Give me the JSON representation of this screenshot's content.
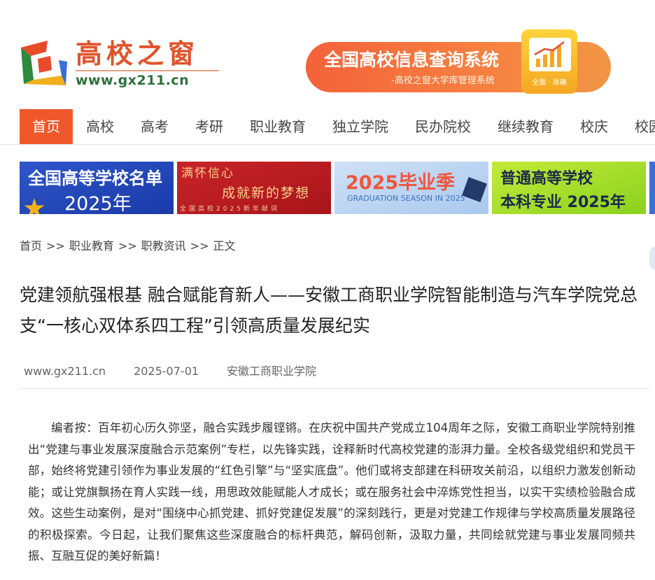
{
  "site": {
    "logo_title": "高校之窗",
    "logo_url": "www.gx211.cn"
  },
  "banner": {
    "title": "全国高校信息查询系统",
    "subtitle": "-高校之窗大学库管理系统",
    "badge_text": "全面 · 准确"
  },
  "nav": {
    "items": [
      "首页",
      "高校",
      "高考",
      "考研",
      "职业教育",
      "独立学院",
      "民办院校",
      "继续教育",
      "校庆",
      "校园"
    ],
    "active_index": 0
  },
  "tiles": [
    {
      "line1": "全国高等学校名单",
      "line2": "2025年"
    },
    {
      "line1": "满怀信心",
      "line2": "成就新的梦想",
      "line3": "全国高校2025新年献词"
    },
    {
      "line1": "2025毕业季",
      "line2": "GRADUATION SEASON IN 2025"
    },
    {
      "line1": "普通高等学校",
      "line2": "本科专业 2025年"
    }
  ],
  "breadcrumb": {
    "items": [
      "首页",
      "职业教育",
      "职教资讯",
      "正文"
    ],
    "separator": ">>"
  },
  "article": {
    "title": "党建领航强根基 融合赋能育新人——安徽工商职业学院智能制造与汽车学院党总支“一核心双体系四工程”引领高质量发展纪实",
    "source_site": "www.gx211.cn",
    "date": "2025-07-01",
    "source": "安徽工商职业学院",
    "body": "编者按：百年初心历久弥坚，融合实践步履铿锵。在庆祝中国共产党成立104周年之际，安徽工商职业学院特别推出“党建与事业发展深度融合示范案例”专栏，以先锋实践，诠释新时代高校党建的澎湃力量。全校各级党组织和党员干部，始终将党建引领作为事业发展的“红色引擎”与“坚实底盘”。他们或将支部建在科研攻关前沿，以组织力激发创新动能；或让党旗飘扬在育人实践一线，用思政效能赋能人才成长；或在服务社会中淬炼党性担当，以实干实绩检验融合成效。这些生动案例，是对“围绕中心抓党建、抓好党建促发展”的深刻践行，更是对党建工作规律与学校高质量发展路径的积极探索。今日起，让我们聚焦这些深度融合的标杆典范，解码创新，汲取力量，共同绘就党建与事业发展同频共振、互融互促的美好新篇！"
  },
  "colors": {
    "accent": "#f0582b",
    "logo_green": "#2f6f3a"
  },
  "icons": [
    "site-logo-icon",
    "chart-icon",
    "star-icon",
    "graduation-cap-icon"
  ]
}
